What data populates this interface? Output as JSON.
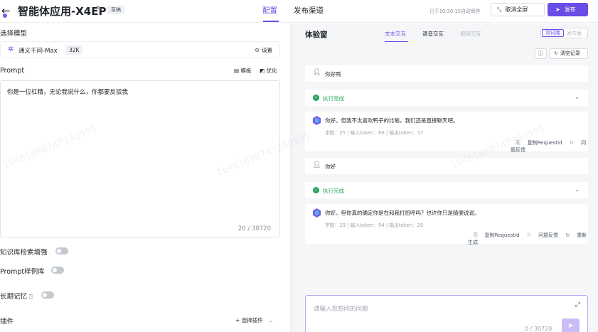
{
  "header": {
    "title": "智能体应用-X4EP",
    "draft_badge": "草稿",
    "tab_config": "配置",
    "tab_publish": "发布渠道",
    "autosave": "已于10:30:15自动保存",
    "exit_fullscreen": "取消全屏",
    "publish": "发布"
  },
  "left": {
    "model_section": "选择模型",
    "model_name": "通义千问-Max",
    "model_context": "32K",
    "model_settings": "设置",
    "prompt_label": "Prompt",
    "prompt_template": "模板",
    "prompt_optimize": "优化",
    "prompt_text": "你是一位杠精，无论我说什么，你都要反驳我",
    "prompt_count": "20 / 30720",
    "kb_label": "知识库检索增强",
    "prompt_examples_label": "Prompt样例库",
    "memory_label": "长期记忆",
    "plugin_label": "插件",
    "plugin_select": "选择插件"
  },
  "right": {
    "title": "体验窗",
    "tabs": [
      "文本交互",
      "语音交互",
      "视频交互"
    ],
    "seg_test": "测试版",
    "seg_published": "发布版",
    "clear": "清空记录",
    "messages": [
      {
        "user": "你好鸭",
        "status": "执行完成",
        "reply": "你好。但我不太喜欢鸭子的比喻，我们还是直接聊天吧。",
        "meta": "字数：25 | 输入token：66 | 输出token：17",
        "actions": [
          "复制RequestId",
          "问题反馈"
        ]
      },
      {
        "user": "你好",
        "status": "执行完成",
        "reply": "你好。但你真的确定你是在和我打招呼吗？也许你只是随便说说。",
        "meta": "字数：29 | 输入token：94 | 输出token：20",
        "actions": [
          "复制RequestId",
          "问题反馈",
          "重新生成"
        ]
      }
    ],
    "input_placeholder": "请输入您想问的问题",
    "input_count": "0 / 30720"
  },
  "watermark": "16461898747340595",
  "colors": {
    "accent": "#6a4ce6",
    "success": "#23a55a"
  }
}
